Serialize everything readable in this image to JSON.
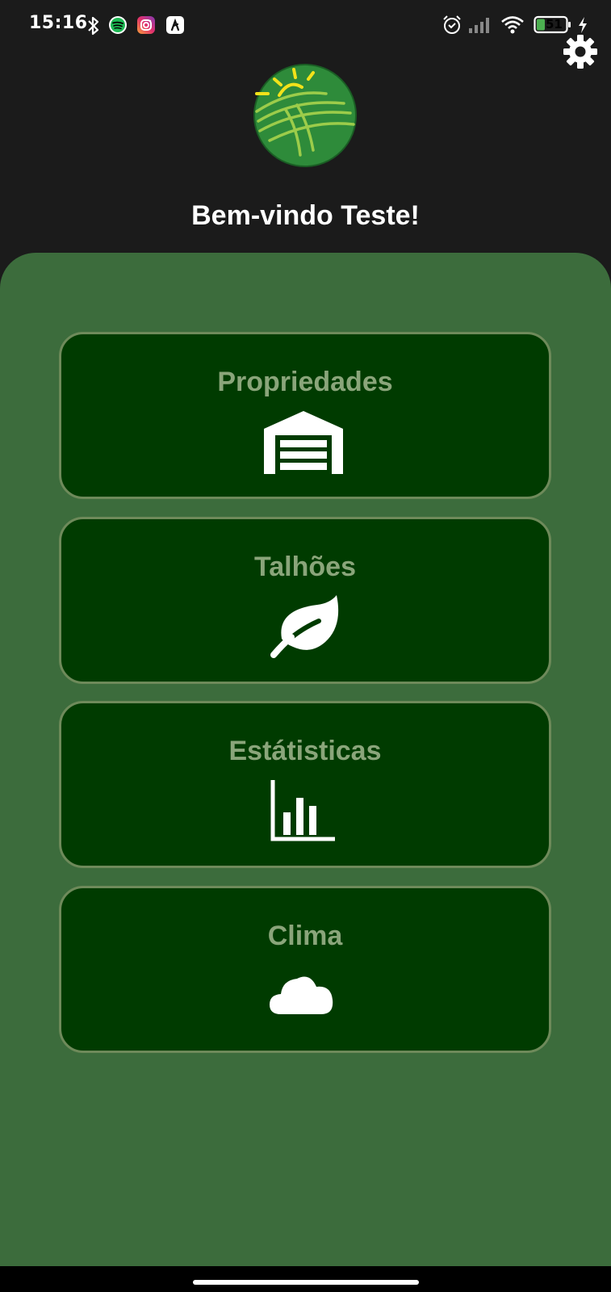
{
  "status_bar": {
    "time": "15:16",
    "battery": "51",
    "icons": [
      "bluetooth-icon",
      "spotify-icon",
      "instagram-icon",
      "app-icon",
      "alarm-icon",
      "signal-icon",
      "wifi-icon",
      "battery-icon",
      "charging-icon"
    ]
  },
  "header": {
    "welcome": "Bem-vindo Teste!",
    "settings_icon": "gear-icon",
    "logo_icon": "farm-sun-fields-logo"
  },
  "menu": [
    {
      "label": "Propriedades",
      "icon": "warehouse-icon"
    },
    {
      "label": "Talhões",
      "icon": "leaf-icon"
    },
    {
      "label": "Estátisticas",
      "icon": "bar-chart-icon"
    },
    {
      "label": "Clima",
      "icon": "cloud-icon"
    }
  ],
  "colors": {
    "top_background": "#1b1b1b",
    "panel": "#3c6c3c",
    "card": "#003b00",
    "card_border": "#6e8a5a",
    "card_label": "#8aa57a",
    "logo_green": "#2e8b3a",
    "logo_sun": "#f2e21a"
  }
}
